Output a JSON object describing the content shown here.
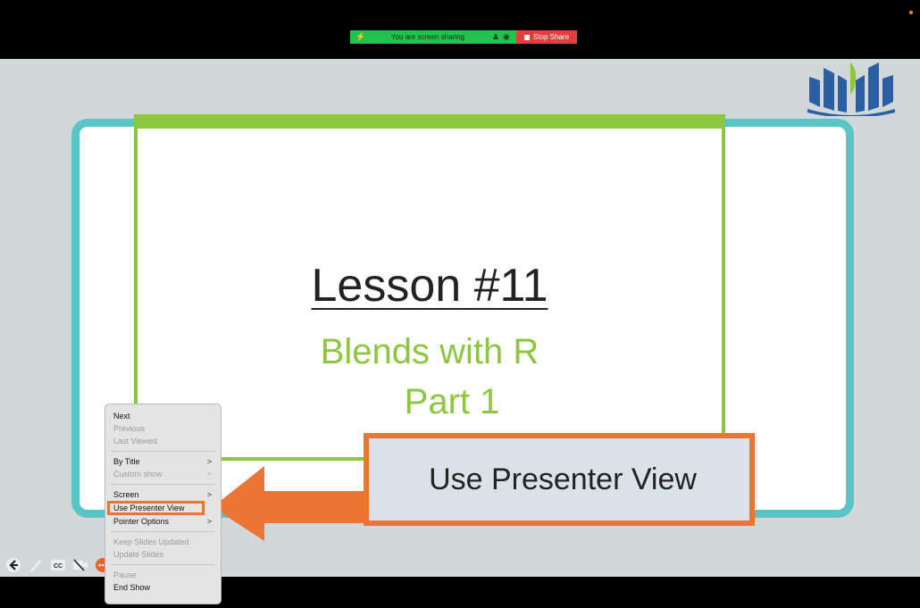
{
  "share_banner": {
    "status_text": "You are screen sharing",
    "stop_label": "Stop Share",
    "green_color": "#22c34c",
    "red_color": "#e73d3d"
  },
  "slide": {
    "title": "Lesson #11",
    "subtitle_line1": "Blends with R",
    "subtitle_line2": "Part 1",
    "frame_color": "#58c6c7",
    "accent_color": "#8dc63f"
  },
  "callout": {
    "label": "Use Presenter View",
    "border_color": "#ec7536"
  },
  "menu": {
    "items": [
      {
        "label": "Next"
      },
      {
        "label": "Previous"
      },
      {
        "label": "Last Viewed"
      },
      {
        "label": "By Title"
      },
      {
        "label": "Custom show"
      },
      {
        "label": "Screen"
      },
      {
        "label": "Use Presenter View"
      },
      {
        "label": "Pointer Options"
      },
      {
        "label": "Keep Slides Updated"
      },
      {
        "label": "Update Slides"
      },
      {
        "label": "Pause"
      },
      {
        "label": "End Show"
      }
    ]
  },
  "controls": {
    "icons": [
      "back-arrow-icon",
      "pen-icon",
      "captions-icon",
      "video-off-icon",
      "more-options-icon"
    ]
  }
}
